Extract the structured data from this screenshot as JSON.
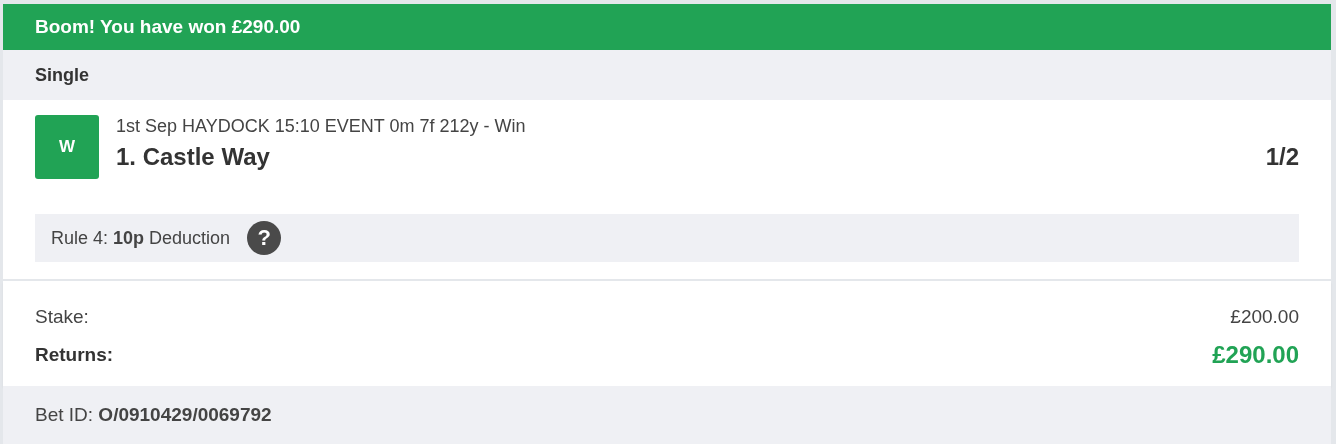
{
  "banner": {
    "title": "Boom! You have won £290.00"
  },
  "bet_type": "Single",
  "selection": {
    "result": "W",
    "event": "1st Sep HAYDOCK 15:10 EVENT 0m 7f 212y - Win",
    "name": "1. Castle Way",
    "odds": "1/2"
  },
  "rule4": {
    "text": "Rule 4: **10p** Deduction",
    "help": "?"
  },
  "summary": [
    {
      "label": "Stake:",
      "value": "£200.00",
      "kind": "stake"
    },
    {
      "label": "Returns:",
      "value": "£290.00",
      "kind": "returns"
    }
  ],
  "bet_id": "Bet ID: **O/0910429/0069792**"
}
